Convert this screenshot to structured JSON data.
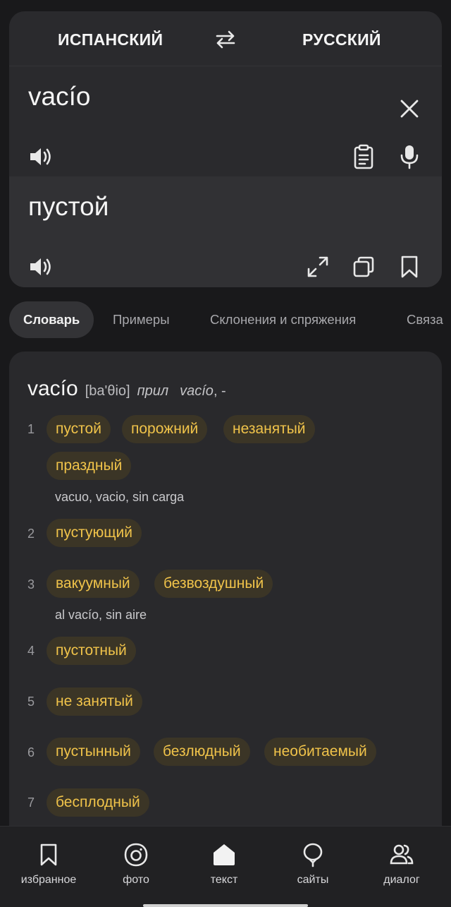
{
  "languages": {
    "source": "ИСПАНСКИЙ",
    "target": "РУССКИЙ",
    "swap_icon": "swap-arrows-icon"
  },
  "source": {
    "text": "vacío",
    "icons": [
      "speaker-icon",
      "clipboard-icon",
      "microphone-icon",
      "clear-icon"
    ]
  },
  "translation": {
    "text": "пустой",
    "icons": [
      "speaker-icon",
      "fullscreen-icon",
      "copy-icon",
      "bookmark-icon"
    ]
  },
  "tabs": [
    {
      "label": "Словарь",
      "active": true
    },
    {
      "label": "Примеры",
      "active": false
    },
    {
      "label": "Склонения и спряжения",
      "active": false
    },
    {
      "label": "Связа",
      "active": false
    }
  ],
  "dictionary": {
    "headword": "vacío",
    "transcription": "[ba'θio]",
    "pos": "прил",
    "forms": "vacío",
    "forms_suffix": ", -",
    "senses": [
      {
        "num": "1",
        "translations": [
          "пустой",
          "порожний",
          "незанятый",
          "праздный"
        ],
        "example": "vacuo, vacio, sin carga"
      },
      {
        "num": "2",
        "translations": [
          "пустующий"
        ]
      },
      {
        "num": "3",
        "translations": [
          "вакуумный",
          "безвоздушный"
        ],
        "example": "al vacío, sin aire"
      },
      {
        "num": "4",
        "translations": [
          "пустотный"
        ]
      },
      {
        "num": "5",
        "translations": [
          "не занятый"
        ]
      },
      {
        "num": "6",
        "translations": [
          "пустынный",
          "безлюдный",
          "необитаемый"
        ]
      },
      {
        "num": "7",
        "translations": [
          "бесплодный"
        ]
      }
    ]
  },
  "bottom_nav": [
    {
      "label": "избранное",
      "icon": "bookmark-icon"
    },
    {
      "label": "фото",
      "icon": "camera-icon"
    },
    {
      "label": "текст",
      "icon": "home-icon"
    },
    {
      "label": "сайты",
      "icon": "balloon-icon"
    },
    {
      "label": "диалог",
      "icon": "people-icon"
    }
  ],
  "colors": {
    "background": "#19191b",
    "card": "#2a2a2d",
    "chip_bg": "#3b3526",
    "chip_text": "#f0c34a"
  }
}
